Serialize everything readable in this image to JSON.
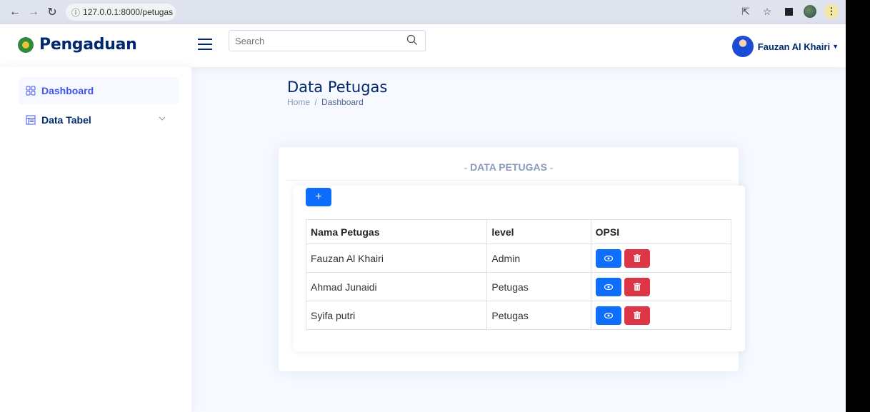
{
  "browser": {
    "url": "127.0.0.1:8000/petugas"
  },
  "header": {
    "brand": "Pengaduan",
    "search_placeholder": "Search",
    "user_name": "Fauzan Al Khairi"
  },
  "sidebar": {
    "items": [
      {
        "label": "Dashboard",
        "icon": "grid-icon"
      },
      {
        "label": "Data Tabel",
        "icon": "table-icon"
      }
    ]
  },
  "page": {
    "title": "Data Petugas",
    "breadcrumb": {
      "home": "Home",
      "sep": "/",
      "current": "Dashboard"
    }
  },
  "card": {
    "title_prefix": "- ",
    "title": "DATA PETUGAS",
    "title_suffix": " -",
    "add_label": "+"
  },
  "table": {
    "headers": [
      "Nama Petugas",
      "level",
      "OPSI"
    ],
    "rows": [
      {
        "name": "Fauzan Al Khairi",
        "level": "Admin"
      },
      {
        "name": "Ahmad Junaidi",
        "level": "Petugas"
      },
      {
        "name": "Syifa putri",
        "level": "Petugas"
      }
    ]
  },
  "colors": {
    "primary": "#0d6efd",
    "danger": "#dc3545",
    "brand": "#012970",
    "accent": "#4154f1"
  }
}
